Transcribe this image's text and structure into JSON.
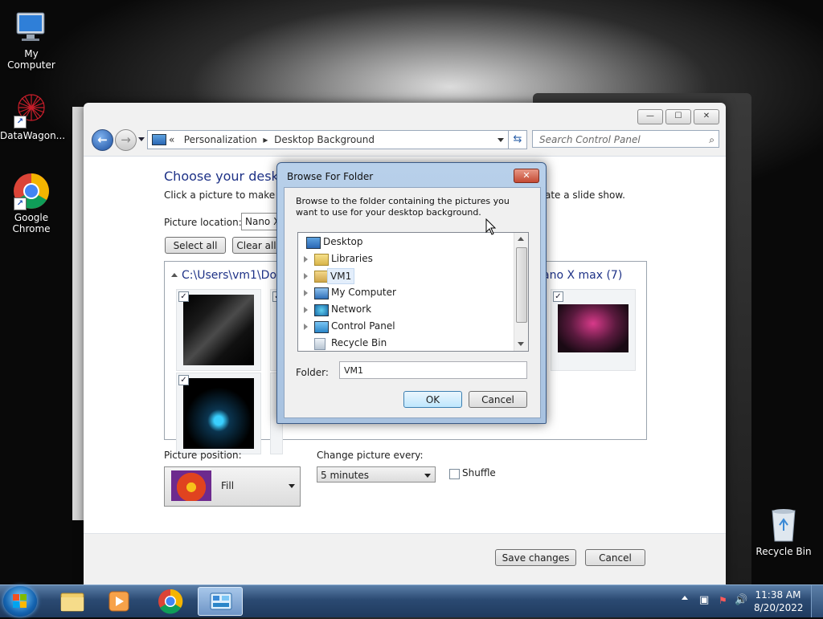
{
  "desktop": {
    "icons": [
      {
        "label": "My Computer"
      },
      {
        "label": "DataWagon..."
      },
      {
        "label": "Google\nChrome"
      },
      {
        "label": "Recycle Bin"
      }
    ]
  },
  "window": {
    "controls": {
      "minimize": "—",
      "maximize": "☐",
      "close": "✕"
    },
    "address": {
      "chevron": "«",
      "crumb1": "Personalization",
      "sep": "▸",
      "crumb2": "Desktop Background"
    },
    "search_placeholder": "Search Control Panel",
    "heading": "Choose your desktop",
    "instruction_left": "Click a picture to make it y",
    "instruction_right": "ate a slide show.",
    "picture_location_label": "Picture location:",
    "picture_location_value": "Nano X",
    "select_all": "Select all",
    "clear_all": "Clear all",
    "group_left": "C:\\Users\\vm1\\Dow",
    "group_right": "ano X max (7)",
    "picture_position_label": "Picture position:",
    "picture_position_value": "Fill",
    "change_every_label": "Change picture every:",
    "change_every_value": "5 minutes",
    "shuffle_label": "Shuffle",
    "save_changes": "Save changes",
    "cancel": "Cancel"
  },
  "dialog": {
    "title": "Browse For Folder",
    "description": "Browse to the folder containing the pictures you want to use for your desktop background.",
    "tree": [
      {
        "label": "Desktop"
      },
      {
        "label": "Libraries"
      },
      {
        "label": "VM1"
      },
      {
        "label": "My Computer"
      },
      {
        "label": "Network"
      },
      {
        "label": "Control Panel"
      },
      {
        "label": "Recycle Bin"
      }
    ],
    "folder_label": "Folder:",
    "folder_value": "VM1",
    "ok": "OK",
    "cancel": "Cancel"
  },
  "taskbar": {
    "time": "11:38 AM",
    "date": "8/20/2022"
  }
}
